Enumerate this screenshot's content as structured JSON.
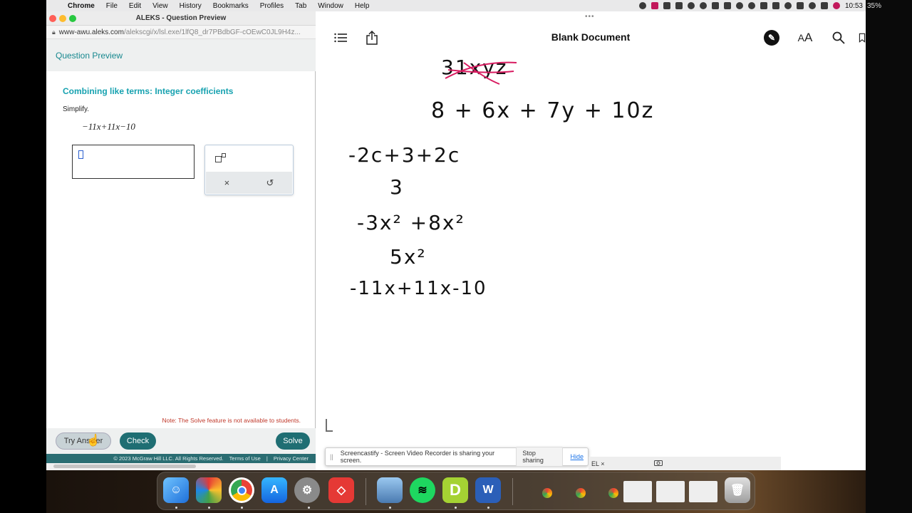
{
  "menubar": {
    "app": "Chrome",
    "items": [
      "File",
      "Edit",
      "View",
      "History",
      "Bookmarks",
      "Profiles",
      "Tab",
      "Window",
      "Help"
    ],
    "battery": "35%",
    "clock": "10:53"
  },
  "aleks": {
    "window_title": "ALEKS - Question Preview",
    "url_host": "www-awu.aleks.com",
    "url_path": "/alekscgi/x/lsl.exe/1lfQ8_dr7PBdbGF-cOEwC0JL9H4z...",
    "header": "Question Preview",
    "topic": "Combining like terms: Integer coefficients",
    "instruction": "Simplify.",
    "expression": "−11x+11x−10",
    "palette": {
      "clear_symbol": "×",
      "undo_symbol": "↺"
    },
    "note": "Note: The Solve feature is not available to students.",
    "buttons": {
      "try": "Try Answer",
      "check": "Check",
      "solve": "Solve"
    },
    "footer": {
      "copyright": "© 2023 McGraw Hill LLC. All Rights Reserved.",
      "terms": "Terms of Use",
      "sep": "|",
      "privacy": "Privacy Center"
    }
  },
  "notes": {
    "title": "Blank Document",
    "drag_handle": "•••",
    "handwriting": [
      "31xyz",
      "8 + 6x + 7y + 10z",
      "-2c+3+2c",
      "3",
      "-3x² +8x²",
      "5x²",
      "-11x+11x-10"
    ]
  },
  "screencastify": {
    "grip": "||",
    "message": "Screencastify - Screen Video Recorder is sharing your screen.",
    "stop": "Stop sharing",
    "hide": "Hide",
    "tab_fragment": "EL",
    "close": "×"
  },
  "icons": {
    "list": "list-icon",
    "share": "share-icon",
    "pen": "pen-icon",
    "text_size": "text-size-icon",
    "search": "search-icon"
  },
  "colors": {
    "aleks_teal": "#17a2b0",
    "aleks_dark": "#1f6e73",
    "note_red": "#c0392b",
    "strike": "#d81b60"
  }
}
